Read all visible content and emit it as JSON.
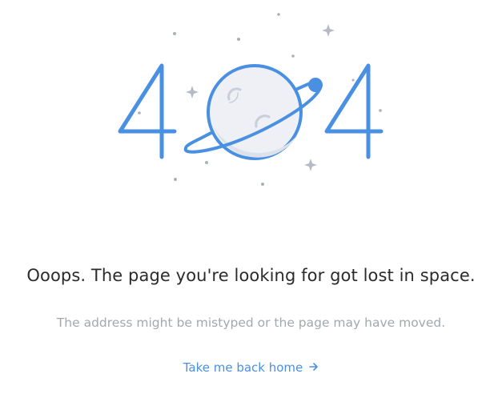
{
  "hero": {
    "digit_left": "4",
    "digit_right": "4",
    "planet_icon": "planet-with-orbit-icon",
    "accent_color": "#4a90e2",
    "planet_fill": "#eef0f5"
  },
  "message": {
    "headline": "Ooops. The page you're looking for got lost in space.",
    "subtext": "The address might be mistyped or the page may have moved."
  },
  "link": {
    "label": "Take me back home",
    "icon": "arrow-right-icon"
  }
}
